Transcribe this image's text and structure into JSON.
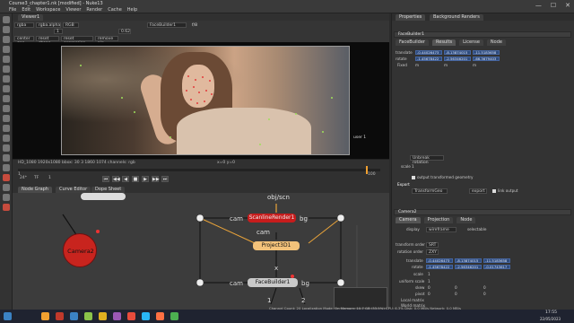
{
  "window": {
    "title": "Course3_chapter1.nk [modified] - Nuke13",
    "menu": [
      "File",
      "Edit",
      "Workspace",
      "Viewer",
      "Render",
      "Cache",
      "Help"
    ],
    "controls": [
      "—",
      "☐",
      "✕"
    ]
  },
  "viewer": {
    "tab": "Viewer1",
    "channels": "rgba",
    "alpha": "rgba.alpha",
    "colorspace": "RGB",
    "input": "FaceBuilder1",
    "gain_value": "1",
    "gamma_value": "0.62",
    "mode_buttons": [
      "center geo",
      "reset shape",
      "reset expression",
      "remove pin"
    ],
    "frame_label": "f/8",
    "overlay_corner": "user 1",
    "info_bar": "HD_1080 1920x1080  bbox: 30 3 1860 1074 channels: rgb",
    "coords": "x=0 y=0"
  },
  "timeline": {
    "fps_label": "24*",
    "range_label": "TF",
    "frame_start": "1",
    "frame_end": "100",
    "current_frame": "1",
    "buttons": [
      "⏮",
      "◀◀",
      "◀",
      "■",
      "▶",
      "▶▶",
      "⏭"
    ],
    "playhead_fraction": 0.96
  },
  "nodegraph": {
    "tabs": [
      "Node Graph",
      "Curve Editor",
      "Dope Sheet"
    ],
    "nodes": {
      "camera": "Camera2",
      "scanline": "ScanlineRender1",
      "project": "Project3D1",
      "facebuilder": "FaceBuilder1",
      "objscn": "obj/scn",
      "cam1": "cam",
      "bg1": "bg",
      "cam2": "cam",
      "cam3": "cam",
      "bg3": "bg",
      "x_label": "x",
      "in1": "1",
      "in2": "2"
    }
  },
  "properties": {
    "tabs": [
      "Properties",
      "Background Renders"
    ],
    "node_name": "FaceBuilder1",
    "subtabs": [
      "FaceBuilder",
      "Results",
      "License",
      "Node"
    ],
    "translate_label": "translate",
    "rotate_label": "rotate",
    "fixed_label": "Fixed",
    "translate": [
      "-0.44026473",
      "-8.13874015",
      "-11.5183658"
    ],
    "rotate": [
      "-1.45678422",
      "-2.56346201",
      "-66.3679403"
    ],
    "fixed_values": [
      "m",
      "m",
      "m"
    ],
    "unbreak_button": "Unbreak rotation",
    "scale_label": "scale",
    "scale_value": "1",
    "output_checkbox": "output transformed geometry",
    "export_label": "Export",
    "export_dropdown": "TransformGeo",
    "export_button": "export",
    "link_checkbox": "link output",
    "camera_node": {
      "name": "Camera2",
      "subtabs": [
        "Camera",
        "Projection",
        "Node"
      ],
      "display_label": "display",
      "display_value": "wireframe",
      "selectable_label": "selectable",
      "transform_order_label": "transform order",
      "transform_order_value": "SRT",
      "rotation_order_label": "rotation order",
      "rotation_order_value": "ZXY",
      "translate_label": "translate",
      "rotate_label": "rotate",
      "scale_label": "scale",
      "translate": [
        "-0.44026473",
        "-8.13874015",
        "-11.5183658"
      ],
      "rotate": [
        "-1.45678422",
        "-2.56346201",
        "-0.01743617"
      ],
      "scale_value": "1",
      "uniform_scale_label": "uniform scale",
      "uniform_scale_value": "1",
      "skew_label": "skew",
      "pivot_label": "pivot",
      "skew_values": [
        "0",
        "0",
        "0"
      ],
      "pivot_values": [
        "0",
        "0",
        "0"
      ],
      "local_matrix_label": "Local matrix",
      "world_matrix_label": "World matrix"
    }
  },
  "statusbar": {
    "text": "Channel Count: 20  Localization Mode: On  Memory: 10.7 GB (33.5%)  CPU: 6.3%  Disk: 0.0 MB/s  Network: 0.0 MB/s"
  },
  "taskbar": {
    "time": "17:55",
    "date": "22/05/2023",
    "colors": [
      "#f0a030",
      "#c0392b",
      "#3b82c4",
      "#8bc34a",
      "#e0b020",
      "#9b59b6",
      "#e74c3c",
      "#29b6f6",
      "#ff7043",
      "#4caf50"
    ]
  }
}
